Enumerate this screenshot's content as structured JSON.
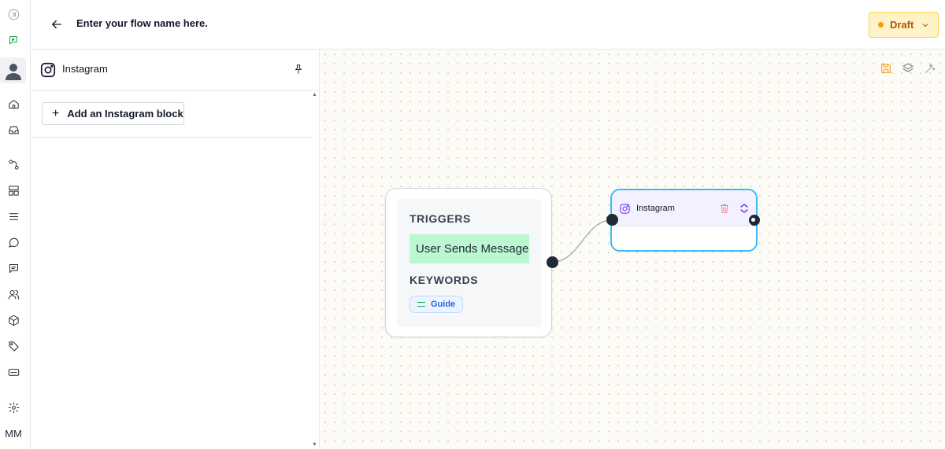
{
  "header": {
    "flow_name": "Enter your flow name here.",
    "status_label": "Draft"
  },
  "rail": {
    "user_initials": "MM",
    "items": [
      {
        "icon": "collapse-icon"
      },
      {
        "icon": "flow-builder-icon"
      },
      {
        "icon": "user-avatar-icon"
      },
      {
        "icon": "home-icon"
      },
      {
        "icon": "inbox-icon"
      },
      {
        "icon": "workflow-icon"
      },
      {
        "icon": "templates-icon"
      },
      {
        "icon": "menu-icon"
      },
      {
        "icon": "chat-icon"
      },
      {
        "icon": "messages-icon"
      },
      {
        "icon": "contacts-icon"
      },
      {
        "icon": "package-icon"
      },
      {
        "icon": "tag-icon"
      },
      {
        "icon": "keyboard-icon"
      },
      {
        "icon": "settings-icon"
      }
    ]
  },
  "panel": {
    "title": "Instagram",
    "add_block_label": "Add an Instagram block"
  },
  "canvas": {
    "trigger_node": {
      "triggers_heading": "TRIGGERS",
      "trigger_value": "User Sends Message",
      "keywords_heading": "KEYWORDS",
      "keyword": "Guide"
    },
    "instagram_node": {
      "title": "Instagram"
    }
  },
  "colors": {
    "draft_bg": "#fef3c7",
    "draft_text": "#b45309",
    "trigger_chip": "#bbf7d0",
    "node_border": "#38bdf8",
    "canvas_bg": "#fdfbf5",
    "accent_orange": "#f59e0b"
  }
}
